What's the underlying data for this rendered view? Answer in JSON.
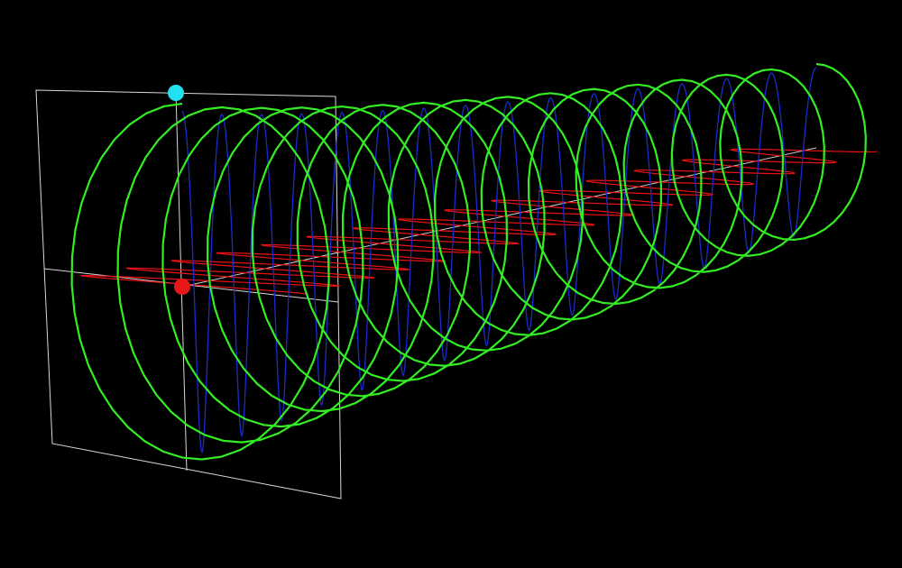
{
  "colors": {
    "background": "#000000",
    "frame": "#d8d8d8",
    "axis": "#cfcfcf",
    "helix": "#33ee22",
    "vertical_wave": "#1a2bcc",
    "horizontal_wave": "#ee1111",
    "vertical_marker": "#22e0f0",
    "horizontal_marker": "#e81818"
  },
  "icons": {
    "vertical_marker": "circle-marker",
    "horizontal_marker": "circle-marker"
  },
  "wave": {
    "cycles": 15
  }
}
